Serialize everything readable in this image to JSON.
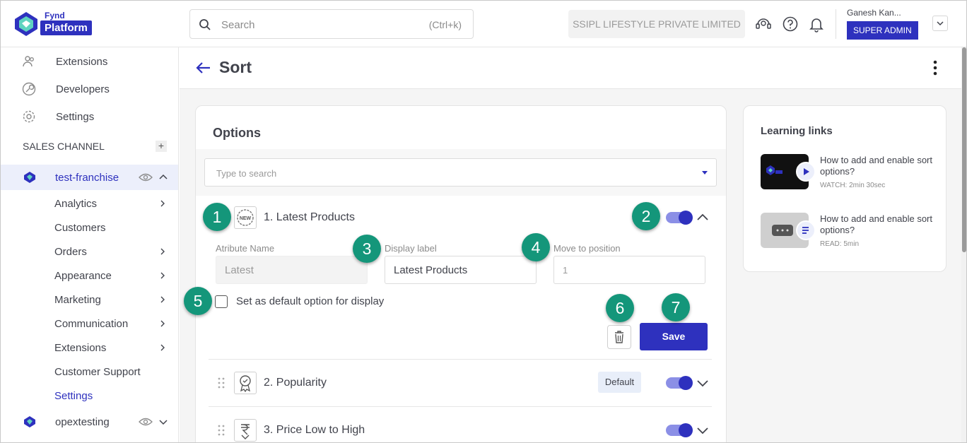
{
  "brand": {
    "fynd": "Fynd",
    "platform": "Platform"
  },
  "header": {
    "search_placeholder": "Search",
    "search_shortcut": "(Ctrl+k)",
    "company": "SSIPL LIFESTYLE PRIVATE LIMITED",
    "user_name": "Ganesh Kan...",
    "role": "SUPER ADMIN"
  },
  "sidebar": {
    "top_items": [
      {
        "label": "Extensions",
        "icon": "people-icon"
      },
      {
        "label": "Developers",
        "icon": "wrench-icon"
      },
      {
        "label": "Settings",
        "icon": "gear-icon"
      }
    ],
    "section": "SALES CHANNEL",
    "store": "test-franchise",
    "sub_items": [
      "Analytics",
      "Customers",
      "Orders",
      "Appearance",
      "Marketing",
      "Communication",
      "Extensions",
      "Customer Support",
      "Settings"
    ],
    "store2": "opextesting"
  },
  "page": {
    "title": "Sort"
  },
  "options": {
    "title": "Options",
    "search_placeholder": "Type to search",
    "rows": [
      {
        "label": "1. Latest Products",
        "enabled": true,
        "expanded": true
      },
      {
        "label": "2. Popularity",
        "enabled": true,
        "badge": "Default"
      },
      {
        "label": "3. Price Low to High",
        "enabled": true
      }
    ],
    "form": {
      "attr_label": "Atribute Name",
      "attr_value": "Latest",
      "display_label": "Display label",
      "display_value": "Latest Products",
      "position_label": "Move to position",
      "position_value": "1",
      "default_checkbox": "Set as default option for display",
      "save": "Save"
    }
  },
  "callouts": [
    "1",
    "2",
    "3",
    "4",
    "5",
    "6",
    "7"
  ],
  "learning": {
    "title": "Learning links",
    "items": [
      {
        "text": "How to add and enable sort options?",
        "sub": "WATCH: 2min 30sec",
        "icon": "play-icon"
      },
      {
        "text": "How to add and enable sort options?",
        "sub": "READ: 5min",
        "icon": "document-icon"
      }
    ]
  },
  "colors": {
    "accent": "#2e31be",
    "callout": "#14967a",
    "toggle_track": "#8b8fe6"
  }
}
